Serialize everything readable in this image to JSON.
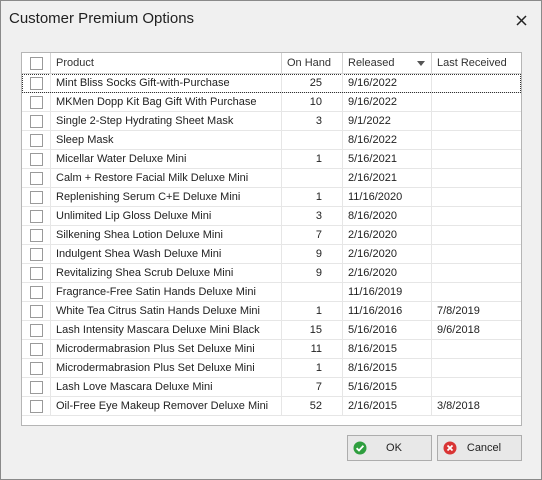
{
  "window": {
    "title": "Customer Premium Options"
  },
  "grid": {
    "columns": {
      "product": "Product",
      "on_hand": "On Hand",
      "released": "Released",
      "last_received": "Last Received"
    },
    "rows": [
      {
        "product": "Mint Bliss Socks Gift-with-Purchase",
        "on_hand": "25",
        "released": "9/16/2022",
        "last_received": ""
      },
      {
        "product": "MKMen Dopp Kit Bag Gift With Purchase",
        "on_hand": "10",
        "released": "9/16/2022",
        "last_received": ""
      },
      {
        "product": "Single 2-Step Hydrating Sheet Mask",
        "on_hand": "3",
        "released": "9/1/2022",
        "last_received": ""
      },
      {
        "product": "Sleep Mask",
        "on_hand": "",
        "released": "8/16/2022",
        "last_received": ""
      },
      {
        "product": "Micellar Water Deluxe Mini",
        "on_hand": "1",
        "released": "5/16/2021",
        "last_received": ""
      },
      {
        "product": "Calm + Restore Facial Milk Deluxe Mini",
        "on_hand": "",
        "released": "2/16/2021",
        "last_received": ""
      },
      {
        "product": "Replenishing Serum C+E Deluxe Mini",
        "on_hand": "1",
        "released": "11/16/2020",
        "last_received": ""
      },
      {
        "product": "Unlimited Lip Gloss Deluxe Mini",
        "on_hand": "3",
        "released": "8/16/2020",
        "last_received": ""
      },
      {
        "product": "Silkening Shea Lotion Deluxe Mini",
        "on_hand": "7",
        "released": "2/16/2020",
        "last_received": ""
      },
      {
        "product": "Indulgent Shea Wash Deluxe Mini",
        "on_hand": "9",
        "released": "2/16/2020",
        "last_received": ""
      },
      {
        "product": "Revitalizing Shea Scrub Deluxe Mini",
        "on_hand": "9",
        "released": "2/16/2020",
        "last_received": ""
      },
      {
        "product": "Fragrance-Free Satin Hands Deluxe Mini",
        "on_hand": "",
        "released": "11/16/2019",
        "last_received": ""
      },
      {
        "product": "White Tea Citrus Satin Hands Deluxe Mini",
        "on_hand": "1",
        "released": "11/16/2016",
        "last_received": "7/8/2019"
      },
      {
        "product": "Lash Intensity Mascara Deluxe Mini Black",
        "on_hand": "15",
        "released": "5/16/2016",
        "last_received": "9/6/2018"
      },
      {
        "product": "Microdermabrasion Plus Set Deluxe Mini",
        "on_hand": "11",
        "released": "8/16/2015",
        "last_received": ""
      },
      {
        "product": "Microdermabrasion Plus Set Deluxe Mini",
        "on_hand": "1",
        "released": "8/16/2015",
        "last_received": ""
      },
      {
        "product": "Lash Love Mascara Deluxe Mini",
        "on_hand": "7",
        "released": "5/16/2015",
        "last_received": ""
      },
      {
        "product": "Oil-Free Eye Makeup Remover Deluxe Mini",
        "on_hand": "52",
        "released": "2/16/2015",
        "last_received": "3/8/2018"
      }
    ]
  },
  "buttons": {
    "ok": "OK",
    "cancel": "Cancel"
  },
  "colors": {
    "ok_icon": "#2e9e3e",
    "cancel_icon": "#d93535"
  },
  "icons": {
    "ok": "check-circle-icon",
    "cancel": "x-circle-icon",
    "close": "close-icon",
    "sort": "sort-descending-icon"
  }
}
